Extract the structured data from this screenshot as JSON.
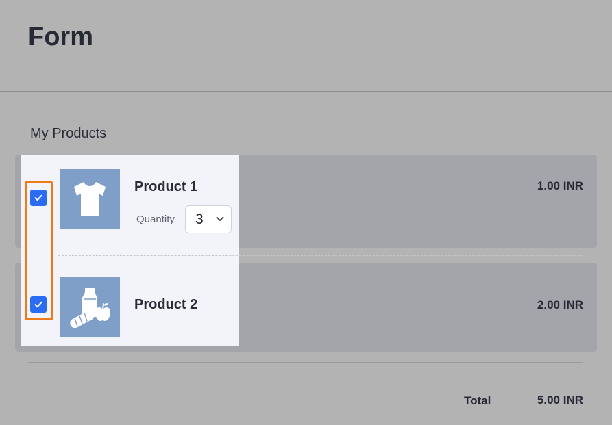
{
  "page": {
    "title": "Form"
  },
  "section": {
    "title": "My Products"
  },
  "products": [
    {
      "name": "Product 1",
      "price": "1.00 INR",
      "checked": true,
      "image_icon": "t-shirt-icon",
      "quantity_label": "Quantity",
      "quantity_value": "3"
    },
    {
      "name": "Product 2",
      "price": "2.00 INR",
      "checked": true,
      "image_icon": "groceries-icon"
    }
  ],
  "summary": {
    "total_label": "Total",
    "total_value": "5.00 INR"
  },
  "colors": {
    "checkbox": "#2b6cf2",
    "highlight": "#ef7a1a",
    "thumbnail": "#7f9fc9",
    "overlay": "#b3b3b3"
  }
}
